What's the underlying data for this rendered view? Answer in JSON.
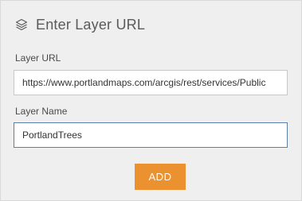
{
  "dialog": {
    "title": "Enter Layer URL",
    "title_icon": "layers-icon"
  },
  "form": {
    "layer_url_label": "Layer URL",
    "layer_url_value": "https://www.portlandmaps.com/arcgis/rest/services/Public",
    "layer_name_label": "Layer Name",
    "layer_name_value": "PortlandTrees"
  },
  "actions": {
    "add_label": "ADD"
  },
  "colors": {
    "panel_background": "#efefef",
    "accent_button": "#eb912f",
    "focused_input_border": "#5b7fa8"
  }
}
